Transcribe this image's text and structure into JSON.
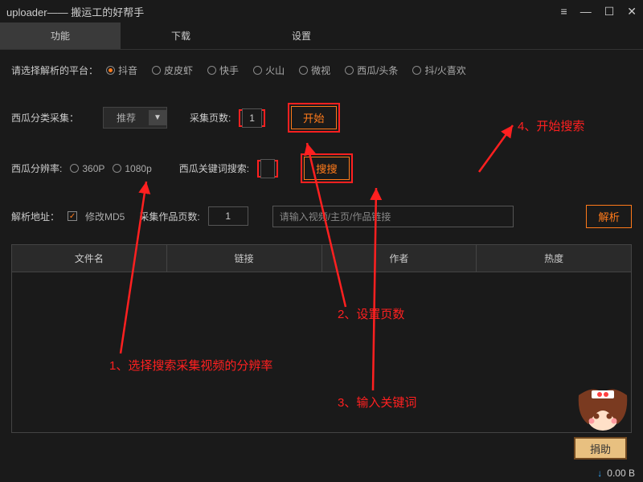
{
  "window": {
    "title": "uploader—— 搬运工的好帮手"
  },
  "tabs": {
    "t0": "功能",
    "t1": "下载",
    "t2": "设置"
  },
  "platform": {
    "label": "请选择解析的平台：",
    "options": [
      "抖音",
      "皮皮虾",
      "快手",
      "火山",
      "微视",
      "西瓜/头条",
      "抖/火喜欢"
    ],
    "selected": 0
  },
  "category": {
    "label": "西瓜分类采集：",
    "select_value": "推荐",
    "pages_label": "采集页数:",
    "pages_value": "1",
    "start_btn": "开始"
  },
  "resolution": {
    "label": "西瓜分辨率:",
    "opt0": "360P",
    "opt1": "1080p",
    "keyword_label": "西瓜关键词搜索:",
    "keyword_value": "",
    "search_btn": "搜搜"
  },
  "parse": {
    "label": "解析地址：",
    "modify_md5": "修改MD5",
    "works_pages_label": "采集作品页数:",
    "works_pages_value": "1",
    "url_placeholder": "请输入视频/主页/作品链接",
    "parse_btn": "解析"
  },
  "table": {
    "c0": "文件名",
    "c1": "链接",
    "c2": "作者",
    "c3": "热度"
  },
  "annotations": {
    "a1": "1、选择搜索采集视频的分辨率",
    "a2": "2、设置页数",
    "a3": "3、输入关键词",
    "a4": "4、开始搜索"
  },
  "donate": "捐助",
  "status": {
    "down_icon": "↓",
    "speed": "0.00 B"
  }
}
